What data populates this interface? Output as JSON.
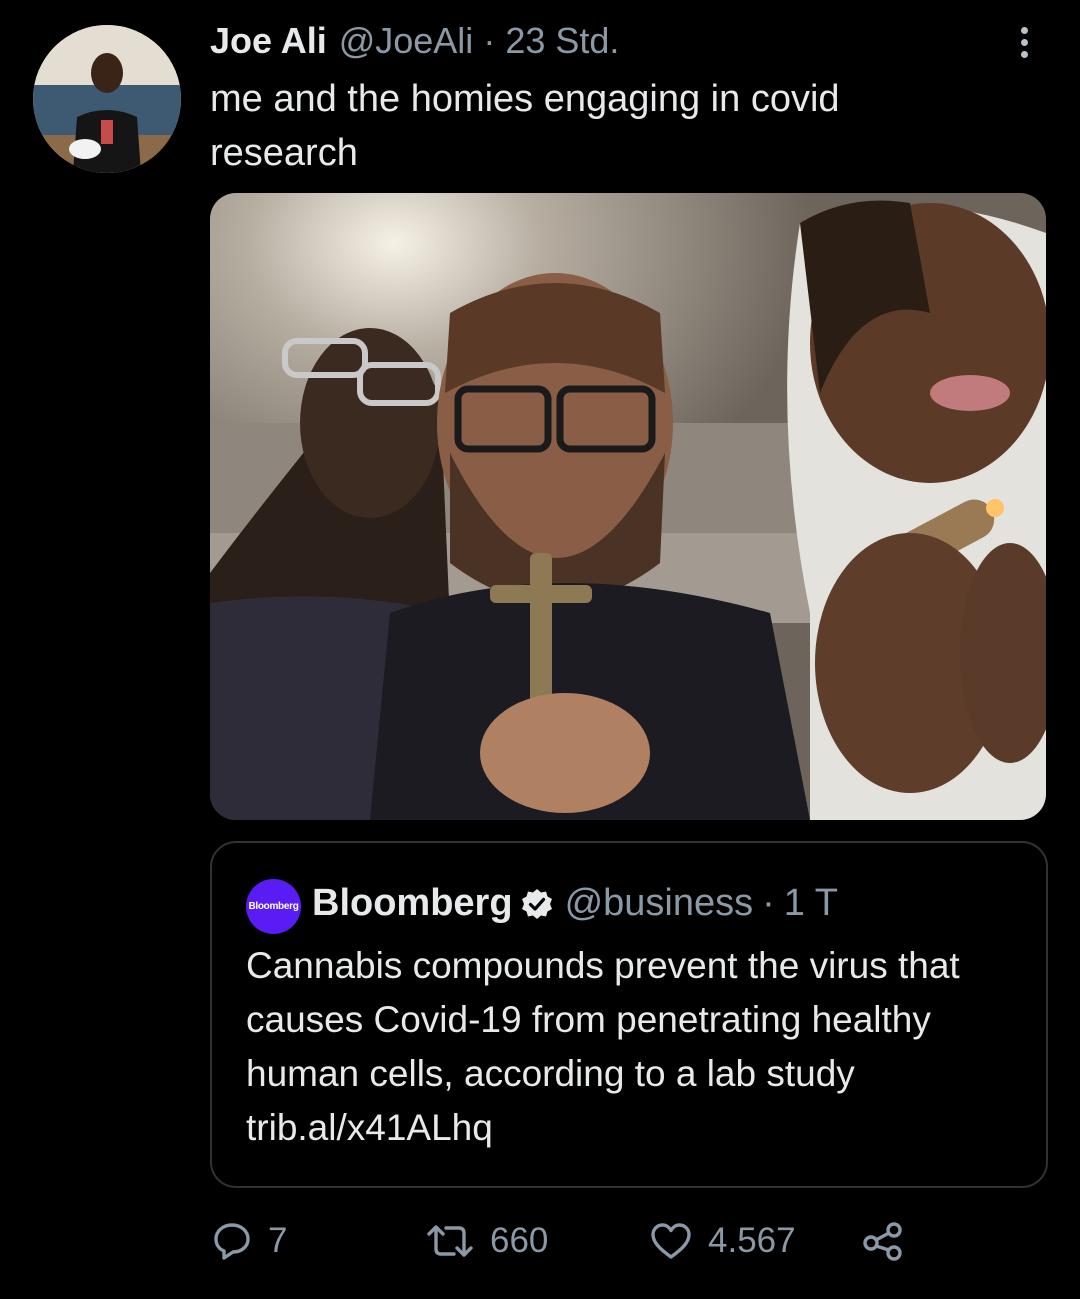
{
  "tweet": {
    "author_name": "Joe Ali",
    "author_handle": "@JoeAli",
    "separator": "·",
    "timestamp": "23 Std.",
    "text": "me and the homies engaging in covid research"
  },
  "quoted_tweet": {
    "avatar_label": "Bloomberg",
    "author_name": "Bloomberg",
    "author_handle": "@business",
    "separator": "·",
    "timestamp": "1 T",
    "text": "Cannabis compounds prevent the virus that causes Covid-19 from penetrating healthy human cells, according to a lab study trib.al/x41ALhq",
    "verified": true
  },
  "actions": {
    "reply_count": "7",
    "retweet_count": "660",
    "like_count": "4.567"
  },
  "icons": {
    "more": "more-vertical-icon",
    "verified": "verified-badge-icon",
    "reply": "reply-icon",
    "retweet": "retweet-icon",
    "like": "heart-icon",
    "share": "share-icon"
  },
  "colors": {
    "background": "#000000",
    "text_primary": "#e7e9ea",
    "text_secondary": "#8b98a5",
    "border": "#2f3336",
    "bloomberg_brand": "#5a1cf5"
  }
}
